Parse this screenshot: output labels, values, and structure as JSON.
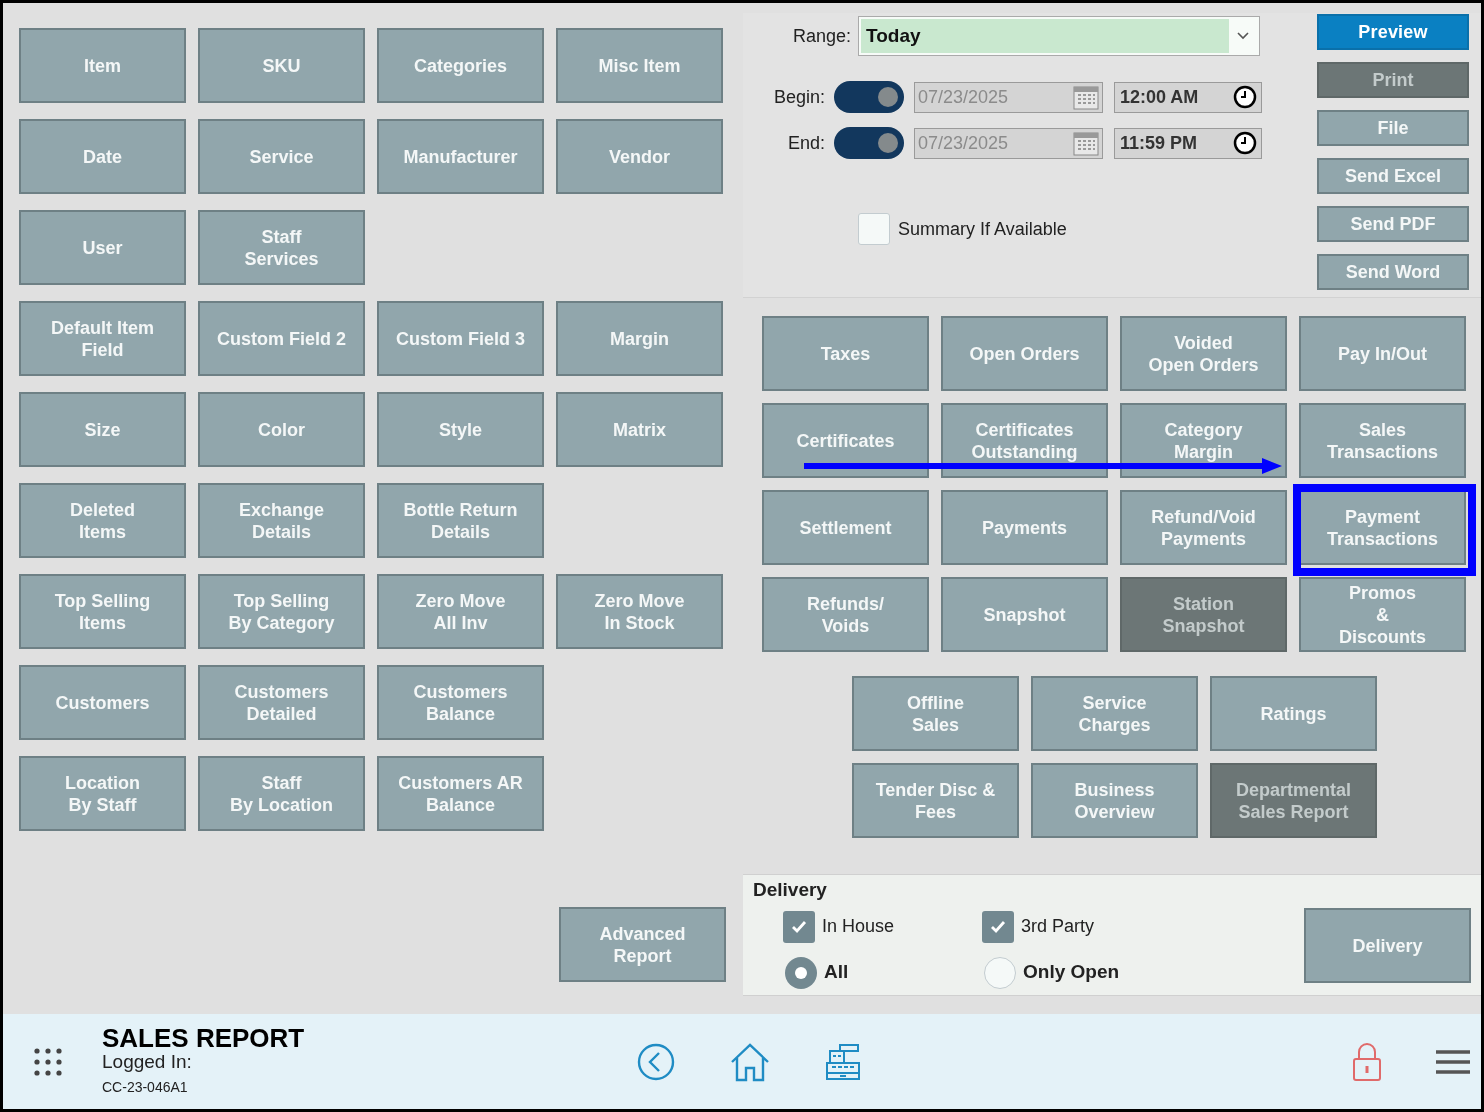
{
  "report_buttons": [
    [
      {
        "label": "Item",
        "disabled": false
      },
      {
        "label": "SKU",
        "disabled": false
      },
      {
        "label": "Categories",
        "disabled": false
      },
      {
        "label": "Misc Item",
        "disabled": false
      }
    ],
    [
      {
        "label": "Date",
        "disabled": false
      },
      {
        "label": "Service",
        "disabled": false
      },
      {
        "label": "Manufacturer",
        "disabled": false
      },
      {
        "label": "Vendor",
        "disabled": false
      }
    ],
    [
      {
        "label": "User",
        "disabled": false
      },
      {
        "label": "Staff\nServices",
        "disabled": false
      }
    ],
    [
      {
        "label": "Default Item\nField",
        "disabled": false
      },
      {
        "label": "Custom Field 2",
        "disabled": false
      },
      {
        "label": "Custom Field 3",
        "disabled": false
      },
      {
        "label": "Margin",
        "disabled": false
      }
    ],
    [
      {
        "label": "Size",
        "disabled": false
      },
      {
        "label": "Color",
        "disabled": false
      },
      {
        "label": "Style",
        "disabled": false
      },
      {
        "label": "Matrix",
        "disabled": false
      }
    ],
    [
      {
        "label": "Deleted\nItems",
        "disabled": false
      },
      {
        "label": "Exchange\nDetails",
        "disabled": false
      },
      {
        "label": "Bottle Return\nDetails",
        "disabled": false
      }
    ],
    [
      {
        "label": "Top Selling\nItems",
        "disabled": false
      },
      {
        "label": "Top Selling\nBy Category",
        "disabled": false
      },
      {
        "label": "Zero Move\nAll Inv",
        "disabled": false
      },
      {
        "label": "Zero Move\nIn Stock",
        "disabled": false
      }
    ],
    [
      {
        "label": "Customers",
        "disabled": false
      },
      {
        "label": "Customers\nDetailed",
        "disabled": false
      },
      {
        "label": "Customers\nBalance",
        "disabled": false
      }
    ],
    [
      {
        "label": "Location\nBy Staff",
        "disabled": false
      },
      {
        "label": "Staff\nBy Location",
        "disabled": false
      },
      {
        "label": "Customers AR\nBalance",
        "disabled": false
      }
    ]
  ],
  "advanced_report": {
    "label": "Advanced\nReport",
    "disabled": false
  },
  "range": {
    "label": "Range:",
    "value": "Today"
  },
  "dates": [
    {
      "label": "Begin:",
      "on": true,
      "date": "07/23/2025",
      "time": "12:00 AM"
    },
    {
      "label": "End:",
      "on": true,
      "date": "07/23/2025",
      "time": "11:59 PM"
    }
  ],
  "summary": {
    "label": "Summary If Available",
    "checked": false
  },
  "actions": [
    {
      "label": "Preview",
      "kind": "primary",
      "disabled": false
    },
    {
      "label": "Print",
      "kind": "normal",
      "disabled": true
    },
    {
      "label": "File",
      "kind": "normal",
      "disabled": false
    },
    {
      "label": "Send Excel",
      "kind": "normal",
      "disabled": false
    },
    {
      "label": "Send PDF",
      "kind": "normal",
      "disabled": false
    },
    {
      "label": "Send Word",
      "kind": "normal",
      "disabled": false
    }
  ],
  "sales_buttons": [
    [
      {
        "label": "Taxes",
        "disabled": false,
        "highlighted": false
      },
      {
        "label": "Open Orders",
        "disabled": false,
        "highlighted": false
      },
      {
        "label": "Voided\nOpen Orders",
        "disabled": false,
        "highlighted": false
      },
      {
        "label": "Pay In/Out",
        "disabled": false,
        "highlighted": false
      }
    ],
    [
      {
        "label": "Certificates",
        "disabled": false,
        "highlighted": false
      },
      {
        "label": "Certificates\nOutstanding",
        "disabled": false,
        "highlighted": false
      },
      {
        "label": "Category\nMargin",
        "disabled": false,
        "highlighted": false
      },
      {
        "label": "Sales\nTransactions",
        "disabled": false,
        "highlighted": false
      }
    ],
    [
      {
        "label": "Settlement",
        "disabled": false,
        "highlighted": false
      },
      {
        "label": "Payments",
        "disabled": false,
        "highlighted": false
      },
      {
        "label": "Refund/Void\nPayments",
        "disabled": false,
        "highlighted": false
      },
      {
        "label": "Payment\nTransactions",
        "disabled": false,
        "highlighted": true
      }
    ],
    [
      {
        "label": "Refunds/\nVoids",
        "disabled": false,
        "highlighted": false
      },
      {
        "label": "Snapshot",
        "disabled": false,
        "highlighted": false
      },
      {
        "label": "Station\nSnapshot",
        "disabled": true,
        "highlighted": false
      },
      {
        "label": "Promos\n&\nDiscounts",
        "disabled": false,
        "highlighted": false
      }
    ]
  ],
  "extra_buttons": [
    [
      {
        "label": "Offline\nSales",
        "disabled": false
      },
      {
        "label": "Service\nCharges",
        "disabled": false
      },
      {
        "label": "Ratings",
        "disabled": false
      }
    ],
    [
      {
        "label": "Tender Disc &\nFees",
        "disabled": false
      },
      {
        "label": "Business\nOverview",
        "disabled": false
      },
      {
        "label": "Departmental\nSales Report",
        "disabled": true
      }
    ]
  ],
  "delivery": {
    "title": "Delivery",
    "checkboxes": [
      {
        "label": "In House",
        "checked": true
      },
      {
        "label": "3rd Party",
        "checked": true
      }
    ],
    "radios": [
      {
        "label": "All",
        "selected": true
      },
      {
        "label": "Only Open",
        "selected": false
      }
    ],
    "button": {
      "label": "Delivery",
      "disabled": false
    }
  },
  "footer": {
    "title": "SALES REPORT",
    "logged_in": "Logged In:",
    "station": "CC-23-046A1"
  }
}
